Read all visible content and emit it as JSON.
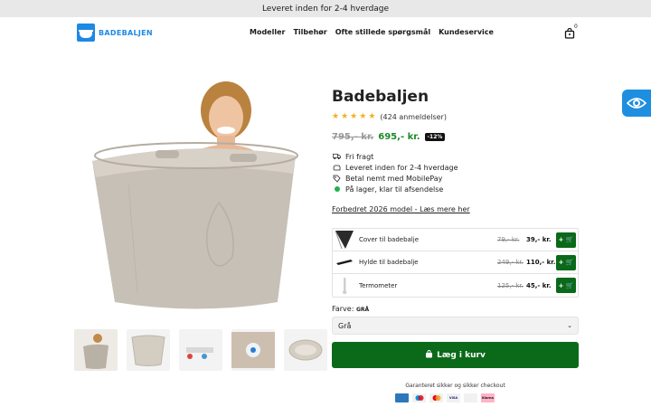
{
  "announcement": "Leveret inden for 2-4 hverdage",
  "logo": {
    "text": "BADEBALJEN"
  },
  "nav": [
    "Modeller",
    "Tilbehør",
    "Ofte stillede spørgsmål",
    "Kundeservice"
  ],
  "cart": {
    "count": "0",
    "icon": "shopping-bag-icon"
  },
  "product": {
    "title": "Badebaljen",
    "rating_count": "(424 anmeldelser)",
    "stars": 5,
    "old_price": "795,- kr.",
    "new_price": "695,- kr.",
    "discount": "-12%",
    "features": [
      {
        "icon": "truck-icon",
        "text": "Fri fragt"
      },
      {
        "icon": "hand-icon",
        "text": "Leveret inden for 2-4 hverdage"
      },
      {
        "icon": "tag-icon",
        "text": "Betal nemt med MobilePay"
      },
      {
        "icon": "stock-dot-icon",
        "text": "På lager, klar til afsendelse"
      }
    ],
    "improved_link": "Forbedret 2026 model - Læs mere her"
  },
  "addons": [
    {
      "name": "Cover til badebalje",
      "old": "79,- kr.",
      "new": "39,- kr.",
      "button": "+"
    },
    {
      "name": "Hylde til badebalje",
      "old": "249,- kr.",
      "new": "110,- kr.",
      "button": "+"
    },
    {
      "name": "Termometer",
      "old": "125,- kr.",
      "new": "45,- kr.",
      "button": "+"
    }
  ],
  "color": {
    "label": "Farve:",
    "value": "GRÅ",
    "selected": "Grå"
  },
  "add_to_cart": "Læg i kurv",
  "secure_text": "Garanteret sikker og sikker checkout",
  "payment_methods": [
    "AMEX",
    "Maestro",
    "Mastercard",
    "VISA",
    "MobilePay",
    "Klarna"
  ],
  "colors": {
    "accent_green": "#0b6a19",
    "price_green": "#1b8a2a",
    "brand_blue": "#1e88e5",
    "star": "#f2b01e"
  }
}
